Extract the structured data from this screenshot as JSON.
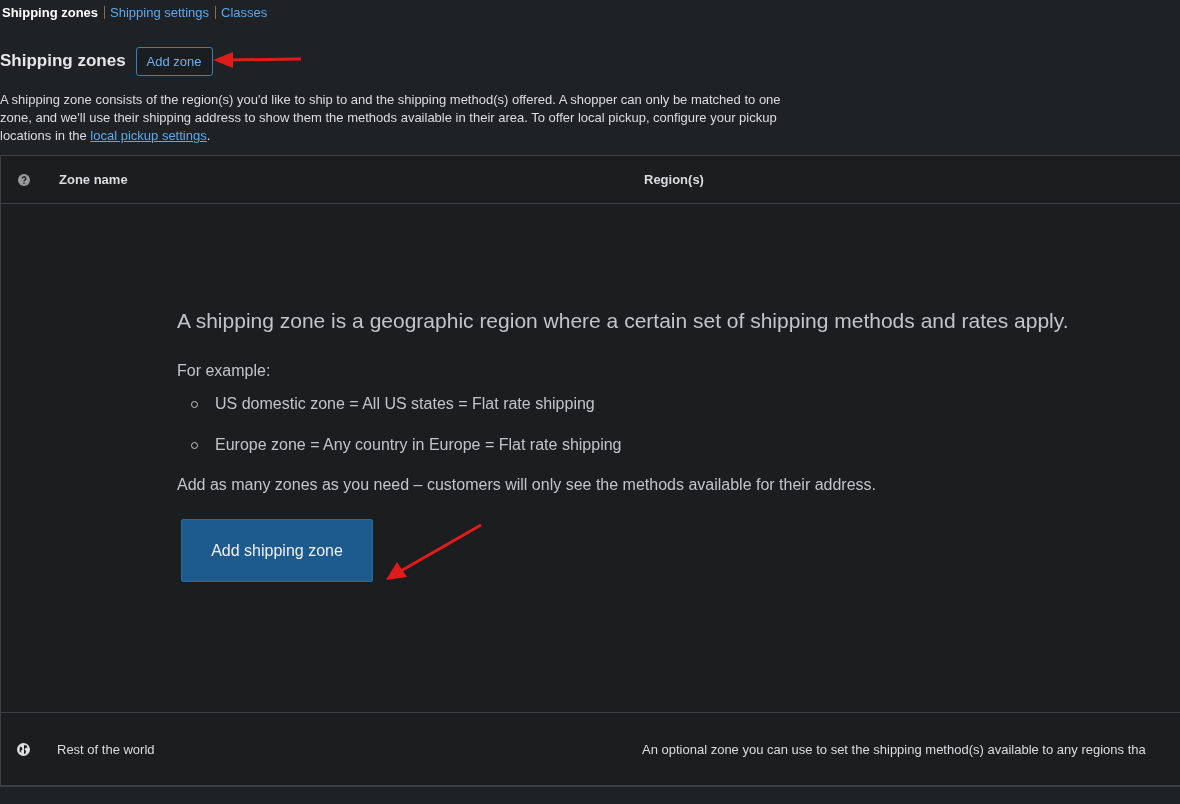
{
  "subnav": [
    {
      "label": "Shipping zones",
      "selected": true
    },
    {
      "label": "Shipping settings",
      "selected": false
    },
    {
      "label": "Classes",
      "selected": false
    }
  ],
  "heading": {
    "title": "Shipping zones",
    "button": "Add zone"
  },
  "description": {
    "text": "A shipping zone consists of the region(s) you'd like to ship to and the shipping method(s) offered. A shopper can only be matched to one zone, and we'll use their shipping address to show them the methods available in their area. To offer local pickup, configure your pickup locations in the",
    "link": "local pickup settings",
    "after": "."
  },
  "table": {
    "columns": [
      "Zone name",
      "Region(s)"
    ],
    "empty_state": {
      "lead": "A shipping zone is a geographic region where a certain set of shipping methods and rates apply.",
      "example_title": "For example:",
      "examples": [
        "US domestic zone = All US states = Flat rate shipping",
        "Europe zone = Any country in Europe = Flat rate shipping"
      ],
      "note": "Add as many zones as you need – customers will only see the methods available for their address.",
      "button": "Add shipping zone"
    },
    "rest_row": {
      "name": "Rest of the world",
      "regions": "An optional zone you can use to set the shipping method(s) available to any regions tha"
    }
  }
}
